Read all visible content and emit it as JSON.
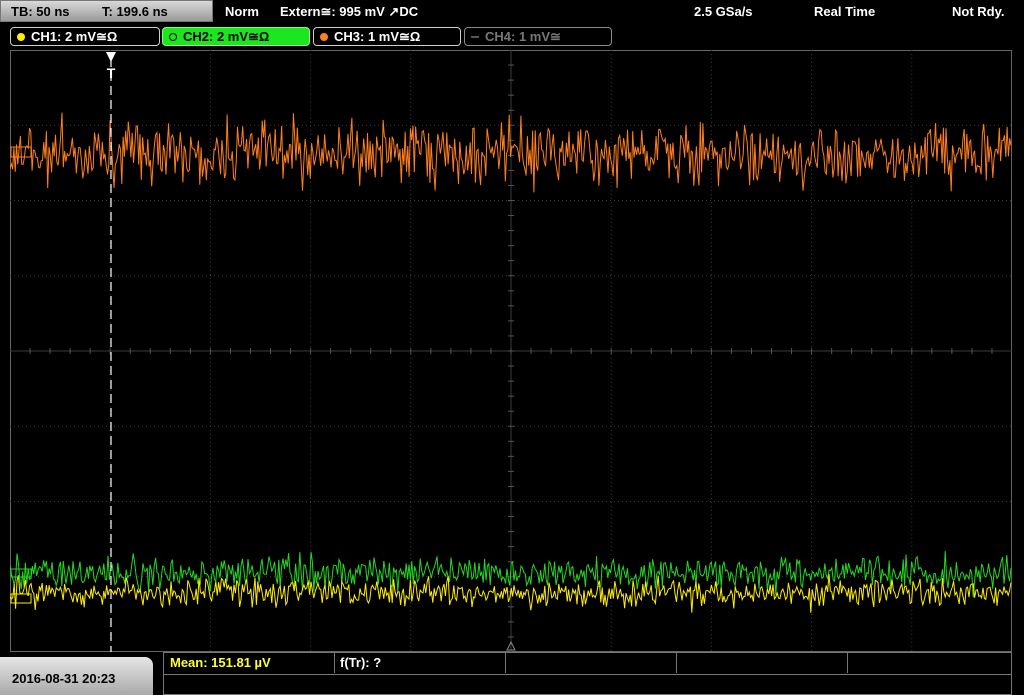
{
  "status": {
    "timebase": "TB: 50 ns",
    "trigger_time": "T: 199.6 ns",
    "mode": "Norm",
    "trigger_source": "Extern≅: 995 mV ↗DC",
    "sample_rate": "2.5 GSa/s",
    "acq_mode": "Real Time",
    "state": "Not Rdy."
  },
  "channels": [
    {
      "label": "CH1: 2 mV≅Ω",
      "color": "#ffee00"
    },
    {
      "label": "CH2: 2 mV≅Ω",
      "color": "#22d822"
    },
    {
      "label": "CH3: 1 mV≅Ω",
      "color": "#ff7f1e"
    },
    {
      "label": "CH4: 1 mV≅",
      "color": "#777777"
    }
  ],
  "trigger_marker": "T",
  "footer": {
    "datetime": "2016-08-31 20:23",
    "mean": "Mean: 151.81 µV",
    "ftr": "f(Tr): ?"
  },
  "traces": {
    "ch3_color": "#ff7f1e",
    "ch2_color": "#22d822",
    "ch1_color": "#ffee00"
  }
}
